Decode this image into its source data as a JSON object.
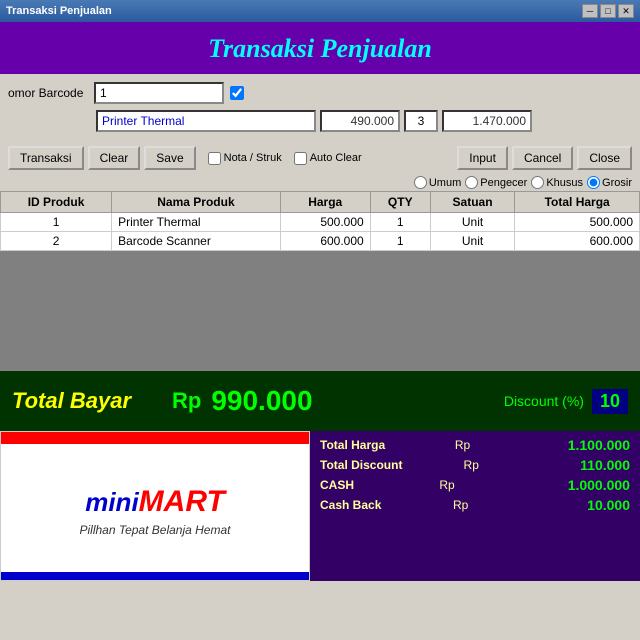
{
  "titleBar": {
    "title": "Transaksi Penjualan"
  },
  "header": {
    "title": "Transaksi Penjualan"
  },
  "form": {
    "barcodeLabel": "omor Barcode",
    "barcodeValue": "1",
    "productName": "Printer Thermal",
    "price": "490.000",
    "qty": "3",
    "total": "1.470.000"
  },
  "buttons": {
    "transaksi": "Transaksi",
    "clear": "Clear",
    "save": "Save",
    "notaStruk": "Nota / Struk",
    "autoClear": "Auto Clear",
    "input": "Input",
    "cancel": "Cancel",
    "close": "Close"
  },
  "pricingModes": [
    {
      "id": "umum",
      "label": "Umum",
      "checked": false
    },
    {
      "id": "pengecer",
      "label": "Pengecer",
      "checked": false
    },
    {
      "id": "khusus",
      "label": "Khusus",
      "checked": false
    },
    {
      "id": "grosir",
      "label": "Grosir",
      "checked": true
    }
  ],
  "table": {
    "headers": [
      "ID Produk",
      "Nama Produk",
      "Harga",
      "QTY",
      "Satuan",
      "Total Harga"
    ],
    "rows": [
      {
        "id": "1",
        "name": "Printer Thermal",
        "harga": "500.000",
        "qty": "1",
        "satuan": "Unit",
        "total": "500.000"
      },
      {
        "id": "2",
        "name": "Barcode Scanner",
        "harga": "600.000",
        "qty": "1",
        "satuan": "Unit",
        "total": "600.000"
      }
    ]
  },
  "totalBayar": {
    "label": "Total Bayar",
    "rp": "Rp",
    "amount": "990.000",
    "discountLabel": "Discount (%)",
    "discountValue": "10"
  },
  "logo": {
    "mini": "mini",
    "mart": "MART",
    "tagline": "Pillhan Tepat Belanja Hemat"
  },
  "summary": {
    "rows": [
      {
        "label": "Total Harga",
        "rp": "Rp",
        "value": "1.100.000"
      },
      {
        "label": "Total Discount",
        "rp": "Rp",
        "value": "110.000"
      },
      {
        "label": "CASH",
        "rp": "Rp",
        "value": "1.000.000"
      },
      {
        "label": "Cash Back",
        "rp": "Rp",
        "value": "10.000"
      }
    ]
  }
}
